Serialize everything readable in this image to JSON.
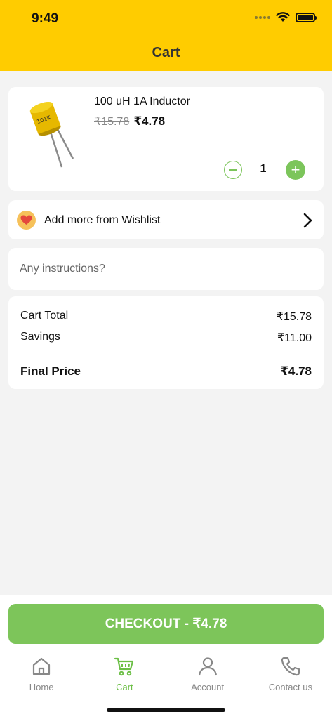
{
  "status_bar": {
    "time": "9:49"
  },
  "header": {
    "title": "Cart"
  },
  "cart_item": {
    "name": "100 uH 1A Inductor",
    "price_original": "₹15.78",
    "price_current": "₹4.78",
    "quantity": "1"
  },
  "wishlist": {
    "label": "Add more from Wishlist"
  },
  "instructions": {
    "placeholder": "Any instructions?"
  },
  "summary": {
    "cart_total_label": "Cart Total",
    "cart_total_value": "₹15.78",
    "savings_label": "Savings",
    "savings_value": "₹11.00",
    "final_label": "Final Price",
    "final_value": "₹4.78"
  },
  "checkout": {
    "label": "CHECKOUT - ₹4.78"
  },
  "tabs": [
    {
      "label": "Home",
      "icon": "home-icon"
    },
    {
      "label": "Cart",
      "icon": "cart-icon",
      "active": true
    },
    {
      "label": "Account",
      "icon": "account-icon"
    },
    {
      "label": "Contact us",
      "icon": "phone-icon"
    }
  ],
  "colors": {
    "header_bg": "#ffcc00",
    "accent_green": "#7dc55a",
    "page_bg": "#f3f3f3"
  }
}
